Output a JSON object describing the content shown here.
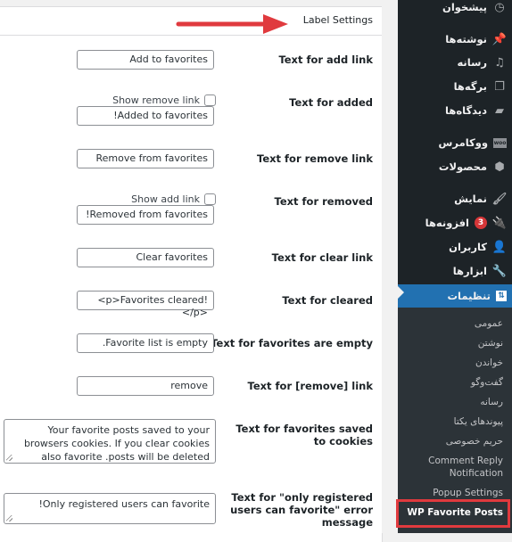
{
  "panel": {
    "title": "Label Settings"
  },
  "settings": [
    {
      "label": "Text for add link",
      "value": "Add to favorites"
    },
    {
      "label": "Text for added",
      "value": "!Added to favorites",
      "checkbox_label": "Show remove link",
      "checked": false
    },
    {
      "label": "Text for remove link",
      "value": "Remove from favorites"
    },
    {
      "label": "Text for removed",
      "value": "!Removed from favorites",
      "checkbox_label": "Show add link",
      "checked": false
    },
    {
      "label": "Text for clear link",
      "value": "Clear favorites"
    },
    {
      "label": "Text for cleared",
      "value": "<p>Favorites cleared!</p>"
    },
    {
      "label": "Text for favorites are empty",
      "value": ".Favorite list is empty"
    },
    {
      "label": "Text for [remove] link",
      "value": "remove"
    },
    {
      "label": "Text for favorites saved to cookies",
      "value": "Your favorite posts saved to your browsers cookies. If you clear cookies also favorite .posts will be deleted"
    },
    {
      "label": "Text for \"only registered users can favorite\" error message",
      "value": "!Only registered users can favorite"
    }
  ],
  "sidebar": {
    "items": [
      {
        "label": "پیشخوان",
        "icon": "dashboard-icon"
      },
      {
        "label": "نوشته‌ها",
        "icon": "pin-icon"
      },
      {
        "label": "رسانه",
        "icon": "media-icon"
      },
      {
        "label": "برگه‌ها",
        "icon": "pages-icon"
      },
      {
        "label": "دیدگاه‌ها",
        "icon": "comments-icon"
      },
      {
        "label": "ووکامرس",
        "icon": "woocommerce-icon"
      },
      {
        "label": "محصولات",
        "icon": "products-icon"
      },
      {
        "label": "نمایش",
        "icon": "appearance-icon"
      },
      {
        "label": "افزونه‌ها",
        "icon": "plugins-icon",
        "badge": "3"
      },
      {
        "label": "کاربران",
        "icon": "users-icon"
      },
      {
        "label": "ابزارها",
        "icon": "tools-icon"
      },
      {
        "label": "تنظیمات",
        "icon": "settings-icon",
        "active": true
      }
    ],
    "submenu": [
      "عمومی",
      "نوشتن",
      "خواندن",
      "گفت‌وگو",
      "رسانه",
      "پیوندهای یکتا",
      "حریم خصوصی",
      "Comment Reply Notification",
      "Popup Settings",
      "WP Favorite Posts"
    ],
    "current_submenu": "WP Favorite Posts"
  },
  "colors": {
    "sidebar_bg": "#1d2327",
    "submenu_bg": "#2c3338",
    "active_bg": "#2271b1",
    "badge": "#d63638",
    "annotation_red": "#e03a3e"
  }
}
